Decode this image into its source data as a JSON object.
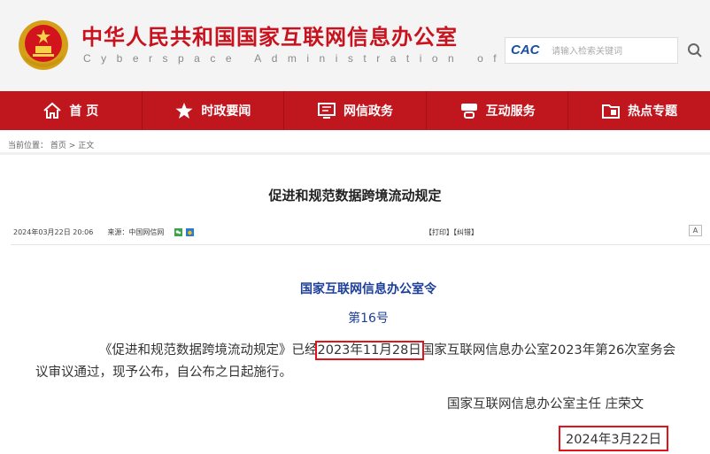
{
  "header": {
    "title": "中华人民共和国国家互联网信息办公室",
    "subtitle": "Cyberspace Administration of China",
    "search_logo": "CAC",
    "search_placeholder": "请输入检索关键词"
  },
  "nav": {
    "items": [
      {
        "label": "首  页",
        "icon": "home-icon"
      },
      {
        "label": "时政要闻",
        "icon": "star-icon"
      },
      {
        "label": "网信政务",
        "icon": "screen-icon"
      },
      {
        "label": "互动服务",
        "icon": "service-icon"
      },
      {
        "label": "热点专题",
        "icon": "folder-icon"
      }
    ]
  },
  "breadcrumb": {
    "prefix": "当前位置：",
    "home": "首页",
    "sep": ">",
    "current": "正文"
  },
  "article": {
    "title": "促进和规范数据跨境流动规定",
    "date": "2024年03月22日  20:06",
    "source_label": "来源：",
    "source": "中国网信网",
    "print": "【打印】",
    "correct": "【纠错】",
    "fontsize_btn": "A"
  },
  "body": {
    "order_title": "国家互联网信息办公室令",
    "order_no": "第16号",
    "para_part1": "《促进和规范数据跨境流动规定》已经",
    "para_highlight": "2023年11月28日",
    "para_part2": "国家互联网信息办公室2023年第26次室务会议审议通过，现予公布，自公布之日起施行。",
    "sign_name": "国家互联网信息办公室主任 庄荣文",
    "sign_date": "2024年3月22日"
  },
  "colors": {
    "brand_red": "#c0161e",
    "title_red": "#c8121e",
    "heading_blue": "#1d3f9a",
    "highlight_red": "#e3131b"
  }
}
